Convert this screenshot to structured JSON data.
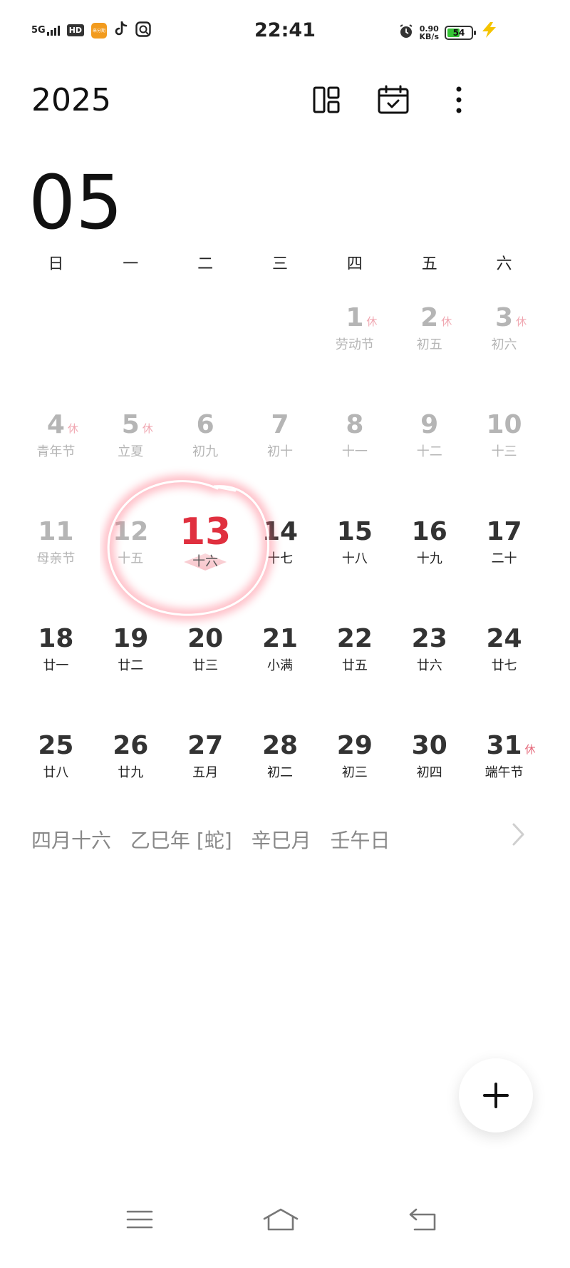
{
  "status_bar": {
    "network": "5G",
    "hd": "HD",
    "app_icon_text": "来分期",
    "time": "22:41",
    "speed_value": "0.90",
    "speed_unit": "KB/s",
    "battery_level": "54",
    "battery_fraction": 0.54,
    "icons": [
      "signal-icon",
      "hd-icon",
      "app-icon",
      "tiktok-icon",
      "browser-icon",
      "alarm-icon",
      "battery-icon",
      "charging-icon"
    ]
  },
  "header": {
    "year": "2025",
    "month": "05",
    "icons": [
      "layout-icon",
      "calendar-check-icon",
      "more-icon"
    ]
  },
  "weekdays": [
    "日",
    "一",
    "二",
    "三",
    "四",
    "五",
    "六"
  ],
  "days": [
    {
      "num": "",
      "lunar": "",
      "blank": true
    },
    {
      "num": "",
      "lunar": "",
      "blank": true
    },
    {
      "num": "",
      "lunar": "",
      "blank": true
    },
    {
      "num": "",
      "lunar": "",
      "blank": true
    },
    {
      "num": "1",
      "lunar": "劳动节",
      "rest": "休",
      "past": true
    },
    {
      "num": "2",
      "lunar": "初五",
      "rest": "休",
      "past": true
    },
    {
      "num": "3",
      "lunar": "初六",
      "rest": "休",
      "past": true
    },
    {
      "num": "4",
      "lunar": "青年节",
      "rest": "休",
      "past": true
    },
    {
      "num": "5",
      "lunar": "立夏",
      "rest": "休",
      "past": true
    },
    {
      "num": "6",
      "lunar": "初九",
      "past": true
    },
    {
      "num": "7",
      "lunar": "初十",
      "past": true
    },
    {
      "num": "8",
      "lunar": "十一",
      "past": true
    },
    {
      "num": "9",
      "lunar": "十二",
      "past": true
    },
    {
      "num": "10",
      "lunar": "十三",
      "past": true
    },
    {
      "num": "11",
      "lunar": "母亲节",
      "past": true
    },
    {
      "num": "12",
      "lunar": "十五",
      "past": true
    },
    {
      "num": "13",
      "lunar": "十六",
      "today": true
    },
    {
      "num": "14",
      "lunar": "十七"
    },
    {
      "num": "15",
      "lunar": "十八"
    },
    {
      "num": "16",
      "lunar": "十九"
    },
    {
      "num": "17",
      "lunar": "二十"
    },
    {
      "num": "18",
      "lunar": "廿一"
    },
    {
      "num": "19",
      "lunar": "廿二"
    },
    {
      "num": "20",
      "lunar": "廿三"
    },
    {
      "num": "21",
      "lunar": "小满"
    },
    {
      "num": "22",
      "lunar": "廿五"
    },
    {
      "num": "23",
      "lunar": "廿六"
    },
    {
      "num": "24",
      "lunar": "廿七"
    },
    {
      "num": "25",
      "lunar": "廿八"
    },
    {
      "num": "26",
      "lunar": "廿九"
    },
    {
      "num": "27",
      "lunar": "五月"
    },
    {
      "num": "28",
      "lunar": "初二"
    },
    {
      "num": "29",
      "lunar": "初三"
    },
    {
      "num": "30",
      "lunar": "初四"
    },
    {
      "num": "31",
      "lunar": "端午节",
      "rest": "休"
    }
  ],
  "lunar_info": {
    "lunar_date": "四月十六",
    "year_gz": "乙巳年 [蛇]",
    "month_gz": "辛巳月",
    "day_gz": "壬午日"
  },
  "colors": {
    "today": "#e0303f",
    "rest": "#e5687a",
    "past": "#b5b5b5",
    "battery": "#35c435",
    "charging": "#f5c400"
  },
  "fab_icon": "plus-icon",
  "nav_icons": [
    "menu-icon",
    "home-icon",
    "back-icon"
  ]
}
